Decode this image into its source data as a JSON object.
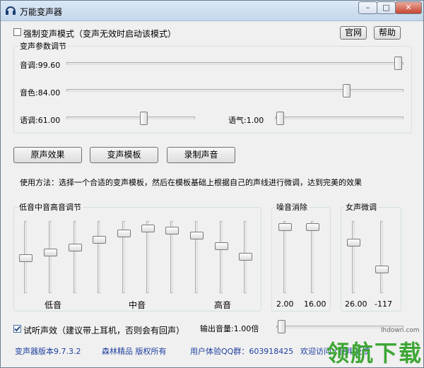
{
  "window": {
    "title": "万能变声器",
    "min_glyph": "–",
    "max_glyph": "□",
    "close_glyph": "✕"
  },
  "top": {
    "force_mode_label": "强制变声模式（变声无效时启动该模式）",
    "force_mode_checked": false,
    "website_button": "官网",
    "help_button": "帮助"
  },
  "params": {
    "title": "变声参数调节",
    "pitch_label": "音调:99.60",
    "pitch_level": 0.996,
    "timbre_label": "音色:84.00",
    "timbre_level": 0.84,
    "speed_label": "语调:61.00",
    "speed_level": 0.61,
    "tone_label": "语气:1.00",
    "tone_level": 0.01
  },
  "buttons": {
    "original": "原声效果",
    "template": "变声模板",
    "record": "录制声音"
  },
  "usage": "使用方法：选择一个合适的变声模板，然后在模板基础上根据自己的声线进行微调，达到完美的效果",
  "eq": {
    "title": "低音中音高音调节",
    "levels": [
      0.48,
      0.57,
      0.65,
      0.77,
      0.87,
      0.95,
      0.91,
      0.83,
      0.67,
      0.51
    ],
    "bass_label": "低音",
    "mid_label": "中音",
    "treble_label": "高音"
  },
  "noise": {
    "title": "噪音消除",
    "left_value": "2.00",
    "left_level": 0.97,
    "right_value": "16.00",
    "right_level": 0.97
  },
  "female": {
    "title": "女声微调",
    "left_value": "26.00",
    "left_level": 0.73,
    "right_value": "-117",
    "right_level": 0.31
  },
  "bottom": {
    "monitor_label": "试听声效（建议带上耳机，否则会有回声）",
    "monitor_checked": true,
    "volume_label": "输出音量:1.00倍",
    "volume_level": 0.01
  },
  "status": {
    "version": "变声器版本9.7.3.2",
    "publisher": "森林精品 版权所有",
    "qq_group": "用户体验QQ群：603918425",
    "tail": "欢迎访问 / 使用反馈"
  },
  "watermark": {
    "site": "lhdown.com",
    "brand": "领航下载",
    "brand_color": "#3ea635"
  }
}
